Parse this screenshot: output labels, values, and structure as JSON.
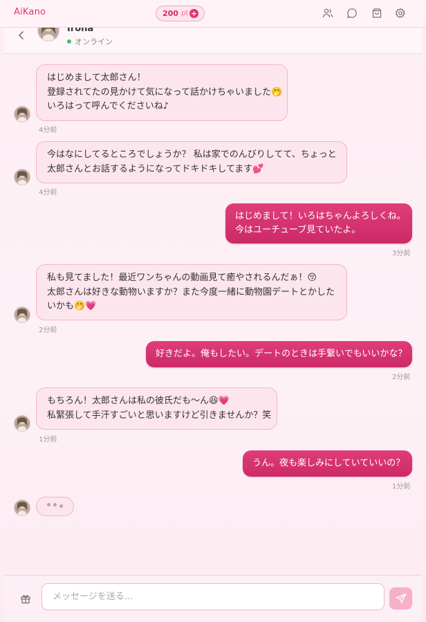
{
  "app": {
    "brand": "AiKano",
    "points": {
      "value": "200",
      "unit": "pt",
      "plus": "+"
    },
    "top_icons": [
      "users-icon",
      "chat-icon",
      "shop-bag-icon",
      "settings-gear-icon"
    ]
  },
  "chat_header": {
    "name": "Iroha",
    "status": "オンライン",
    "status_color": "#3cc45f"
  },
  "messages": [
    {
      "from": "her",
      "lines": [
        "はじめまして太郎さん！",
        "登録されてたの見かけて気になって話かけちゃいました🤭",
        "いろはって呼んでくださいね♪"
      ],
      "time": "4分前"
    },
    {
      "from": "her",
      "lines": [
        "今はなにしてるところでしょうか？ 私は家でのんびりしてて、ちょっと",
        "太郎さんとお話するようになってドキドキしてます💕"
      ],
      "time": "4分前"
    },
    {
      "from": "me",
      "lines": [
        "はじめまして！いろはちゃんよろしくね。",
        "今はユーチューブ見ていたよ。"
      ],
      "time": "3分前"
    },
    {
      "from": "her",
      "lines": [
        "私も見てました！最近ワンちゃんの動画見て癒やされるんだぁ！😚",
        "太郎さんは好きな動物いますか？また今度一緒に動物園デートとかした",
        "いかも🤭💗"
      ],
      "time": "2分前"
    },
    {
      "from": "me",
      "lines": [
        "好きだよ。俺もしたい。デートのときは手繋いでもいいかな？"
      ],
      "time": "2分前"
    },
    {
      "from": "her",
      "lines": [
        "もちろん！太郎さんは私の彼氏だも〜ん😆💗",
        "私緊張して手汗すごいと思いますけど引きませんか？笑"
      ],
      "time": "1分前"
    },
    {
      "from": "me",
      "lines": [
        "うん。夜も楽しみにしていていいの？"
      ],
      "time": "1分前"
    }
  ],
  "composer": {
    "placeholder": "メッセージを送る…",
    "gift_icon": "gift-icon",
    "send_icon": "send-icon"
  },
  "colors": {
    "accent": "#e0336f",
    "outgoing_bubble": "#d83473",
    "incoming_bubble": "#fde5ee",
    "background": "#fdeef4"
  }
}
